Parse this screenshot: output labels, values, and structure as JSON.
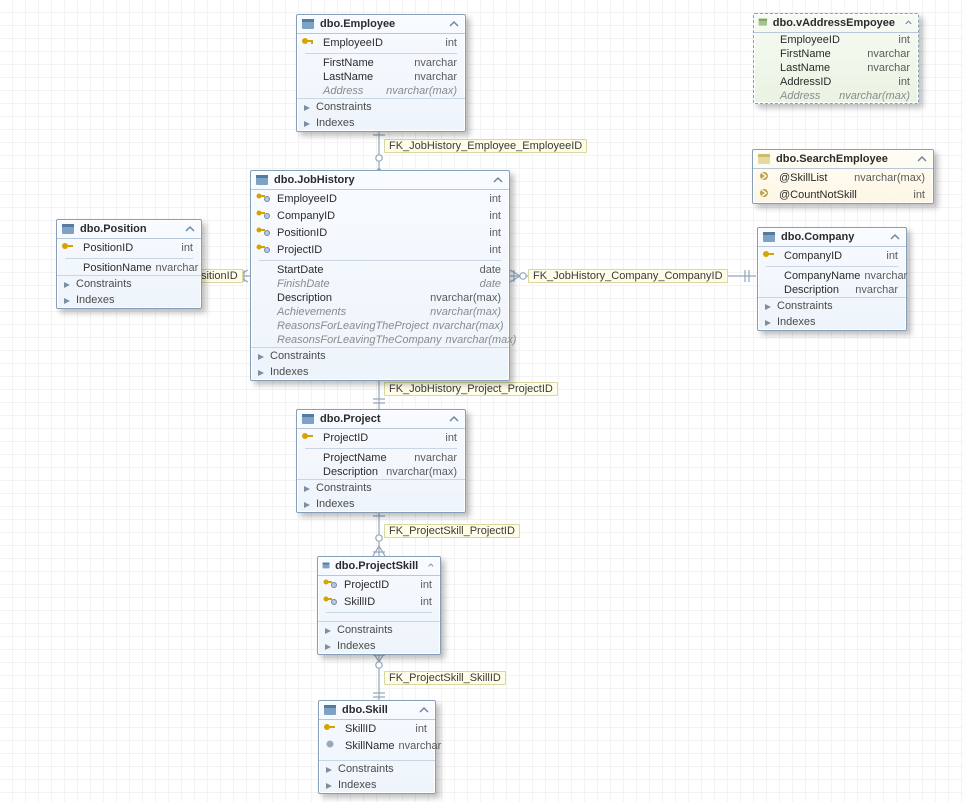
{
  "labels": {
    "constraints": "Constraints",
    "indexes": "Indexes"
  },
  "fk": {
    "emp": "FK_JobHistory_Employee_EmployeeID",
    "pos": "FK_JobHistory_Position_PositionID",
    "com": "FK_JobHistory_Company_CompanyID",
    "prj": "FK_JobHistory_Project_ProjectID",
    "psk": "FK_ProjectSkill_ProjectID",
    "skl": "FK_ProjectSkill_SkillID"
  },
  "employee": {
    "name": "dbo.Employee",
    "cols": [
      {
        "n": "EmployeeID",
        "t": "int"
      },
      {
        "n": "FirstName",
        "t": "nvarchar"
      },
      {
        "n": "LastName",
        "t": "nvarchar"
      },
      {
        "n": "Address",
        "t": "nvarchar(max)"
      }
    ]
  },
  "jobhistory": {
    "name": "dbo.JobHistory",
    "cols": [
      {
        "n": "EmployeeID",
        "t": "int"
      },
      {
        "n": "CompanyID",
        "t": "int"
      },
      {
        "n": "PositionID",
        "t": "int"
      },
      {
        "n": "ProjectID",
        "t": "int"
      },
      {
        "n": "StartDate",
        "t": "date"
      },
      {
        "n": "FinishDate",
        "t": "date"
      },
      {
        "n": "Description",
        "t": "nvarchar(max)"
      },
      {
        "n": "Achievements",
        "t": "nvarchar(max)"
      },
      {
        "n": "ReasonsForLeavingTheProject",
        "t": "nvarchar(max)"
      },
      {
        "n": "ReasonsForLeavingTheCompany",
        "t": "nvarchar(max)"
      }
    ]
  },
  "position": {
    "name": "dbo.Position",
    "cols": [
      {
        "n": "PositionID",
        "t": "int"
      },
      {
        "n": "PositionName",
        "t": "nvarchar"
      }
    ]
  },
  "company": {
    "name": "dbo.Company",
    "cols": [
      {
        "n": "CompanyID",
        "t": "int"
      },
      {
        "n": "CompanyName",
        "t": "nvarchar"
      },
      {
        "n": "Description",
        "t": "nvarchar"
      }
    ]
  },
  "project": {
    "name": "dbo.Project",
    "cols": [
      {
        "n": "ProjectID",
        "t": "int"
      },
      {
        "n": "ProjectName",
        "t": "nvarchar"
      },
      {
        "n": "Description",
        "t": "nvarchar(max)"
      }
    ]
  },
  "projectskill": {
    "name": "dbo.ProjectSkill",
    "cols": [
      {
        "n": "ProjectID",
        "t": "int"
      },
      {
        "n": "SkillID",
        "t": "int"
      }
    ]
  },
  "skill": {
    "name": "dbo.Skill",
    "cols": [
      {
        "n": "SkillID",
        "t": "int"
      },
      {
        "n": "SkillName",
        "t": "nvarchar"
      }
    ]
  },
  "vaddress": {
    "name": "dbo.vAddressEmpoyee",
    "cols": [
      {
        "n": "EmployeeID",
        "t": "int"
      },
      {
        "n": "FirstName",
        "t": "nvarchar"
      },
      {
        "n": "LastName",
        "t": "nvarchar"
      },
      {
        "n": "AddressID",
        "t": "int"
      },
      {
        "n": "Address",
        "t": "nvarchar(max)"
      }
    ]
  },
  "search": {
    "name": "dbo.SearchEmployee",
    "params": [
      {
        "n": "@SkillList",
        "t": "nvarchar(max)"
      },
      {
        "n": "@CountNotSkill",
        "t": "int"
      }
    ]
  }
}
